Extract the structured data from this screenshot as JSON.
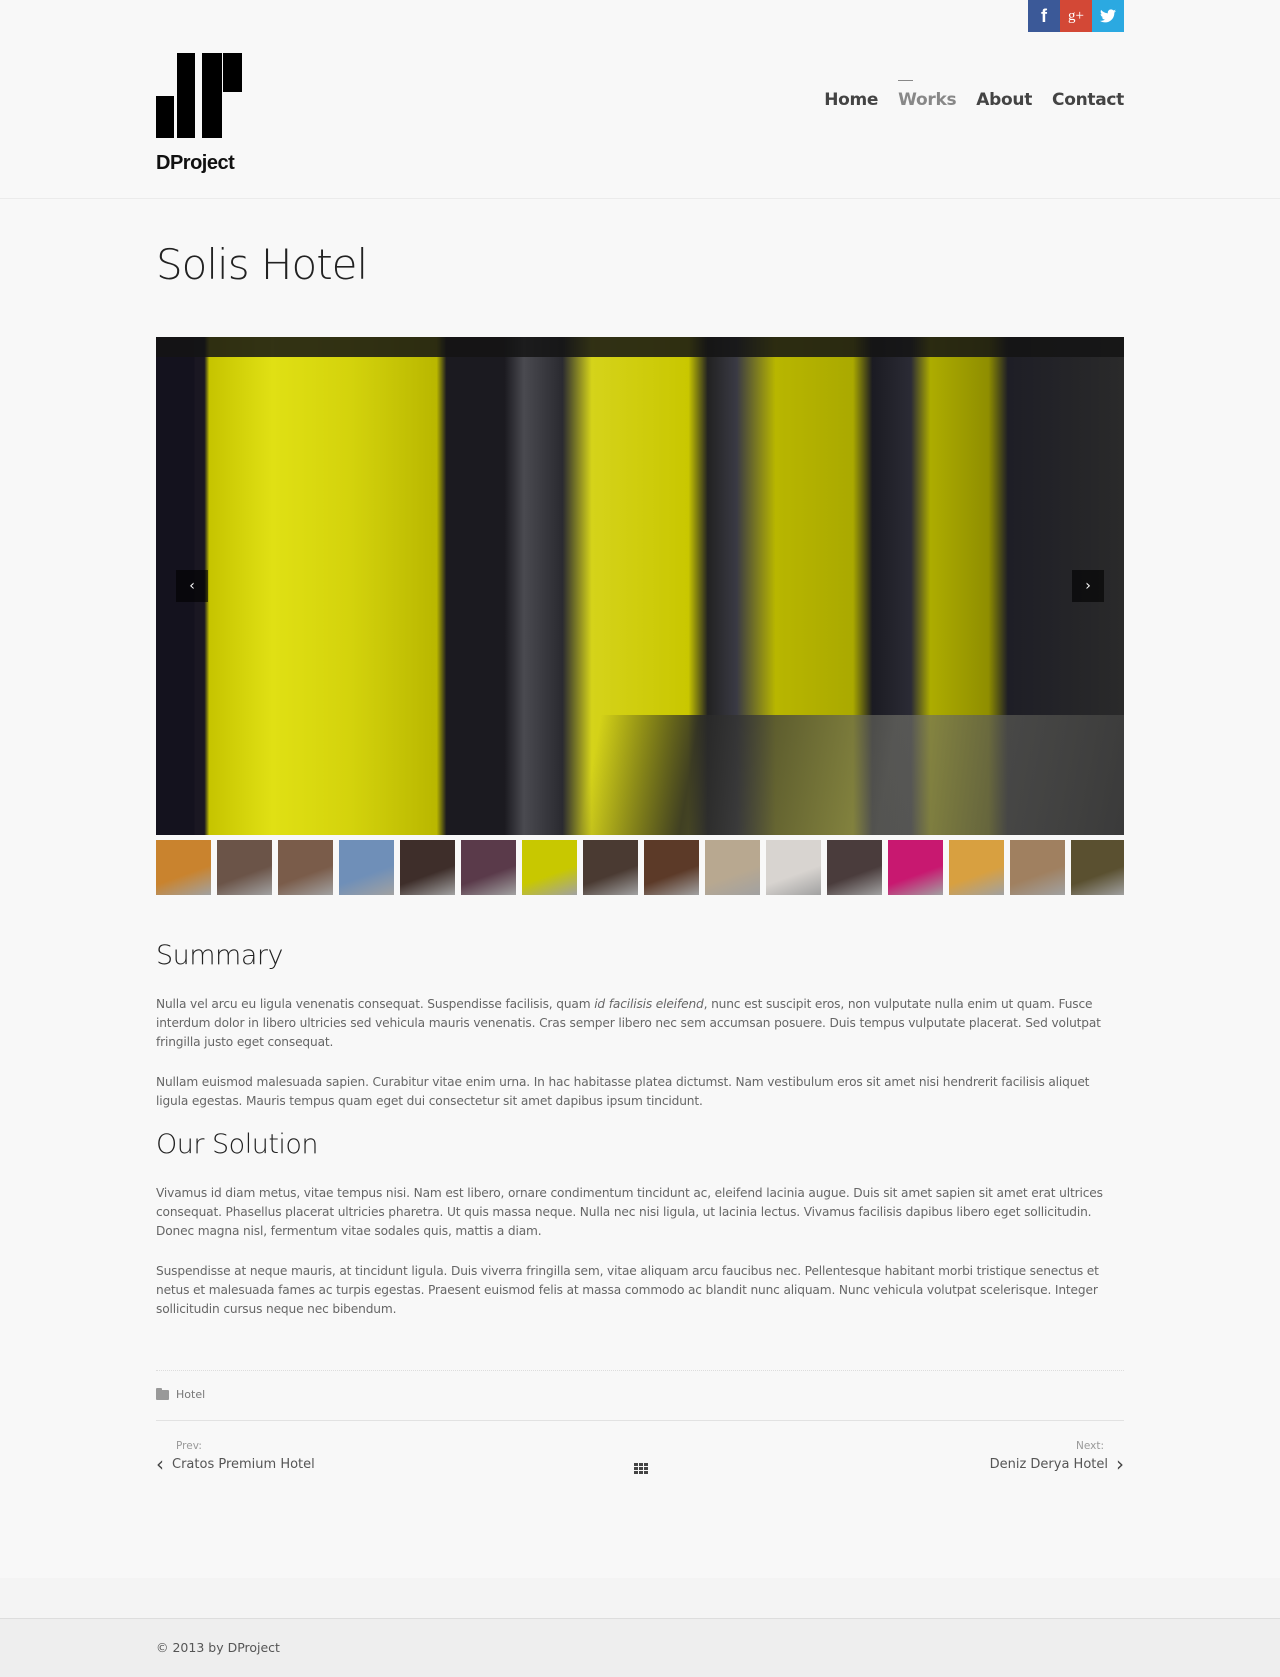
{
  "social": [
    {
      "name": "facebook",
      "glyph": "f",
      "color": "#3b5998"
    },
    {
      "name": "google-plus",
      "glyph": "g+",
      "color": "#d34836"
    },
    {
      "name": "twitter",
      "glyph": "🐦",
      "color": "#2ba9e1"
    }
  ],
  "brand": {
    "name": "DProject"
  },
  "nav": {
    "items": [
      {
        "label": "Home",
        "active": false
      },
      {
        "label": "Works",
        "active": true
      },
      {
        "label": "About",
        "active": false
      },
      {
        "label": "Contact",
        "active": false
      }
    ]
  },
  "page": {
    "title": "Solis Hotel"
  },
  "slider": {
    "prev_glyph": "‹",
    "next_glyph": "›",
    "thumbnails": [
      {
        "desc": "orange sofa",
        "color": "#c9832e"
      },
      {
        "desc": "white shelf",
        "color": "#6b5448"
      },
      {
        "desc": "lobby lounge",
        "color": "#7a5c4a"
      },
      {
        "desc": "mountain view",
        "color": "#6f8fb8"
      },
      {
        "desc": "dark corridor",
        "color": "#3e2e2a"
      },
      {
        "desc": "purple room",
        "color": "#5a3a4a"
      },
      {
        "desc": "yellow elevators",
        "color": "#c8c800"
      },
      {
        "desc": "brown room",
        "color": "#4a3a32"
      },
      {
        "desc": "wood desk",
        "color": "#5c3a28"
      },
      {
        "desc": "white sofa yellow pillows",
        "color": "#b8a890"
      },
      {
        "desc": "bedroom",
        "color": "#d8d4d0"
      },
      {
        "desc": "lounge table",
        "color": "#4a3c3c"
      },
      {
        "desc": "magenta sofa",
        "color": "#c81870"
      },
      {
        "desc": "golden panel",
        "color": "#d8a040"
      },
      {
        "desc": "wood hall",
        "color": "#a08060"
      },
      {
        "desc": "yellow wall",
        "color": "#5a5030"
      }
    ]
  },
  "sections": {
    "summary": {
      "heading": "Summary",
      "p1_a": "Nulla vel arcu eu ligula venenatis consequat. Suspendisse facilisis, quam ",
      "p1_em": "id facilisis eleifend",
      "p1_b": ", nunc est suscipit eros, non vulputate nulla enim ut quam. Fusce interdum dolor in libero ultricies sed vehicula mauris venenatis. Cras semper libero nec sem accumsan posuere. Duis tempus vulputate placerat. Sed volutpat fringilla justo eget consequat.",
      "p2": "Nullam euismod malesuada sapien. Curabitur vitae enim urna. In hac habitasse platea dictumst. Nam vestibulum eros sit amet nisi hendrerit facilisis aliquet ligula egestas. Mauris tempus quam eget dui consectetur sit amet dapibus ipsum tincidunt."
    },
    "solution": {
      "heading": "Our Solution",
      "p1": "Vivamus id diam metus, vitae tempus nisi. Nam est libero, ornare condimentum tincidunt ac, eleifend lacinia augue. Duis sit amet sapien sit amet erat ultrices consequat. Phasellus placerat ultricies pharetra. Ut quis massa neque. Nulla nec nisi ligula, ut lacinia lectus. Vivamus facilisis dapibus libero eget sollicitudin. Donec magna nisl, fermentum vitae sodales quis, mattis a diam.",
      "p2": "Suspendisse at neque mauris, at tincidunt ligula. Duis viverra fringilla sem, vitae aliquam arcu faucibus nec. Pellentesque habitant morbi tristique senectus et netus et malesuada fames ac turpis egestas. Praesent euismod felis at massa commodo ac blandit nunc aliquam. Nunc vehicula volutpat scelerisque. Integer sollicitudin cursus neque nec bibendum."
    }
  },
  "meta": {
    "category": "Hotel"
  },
  "post_nav": {
    "prev_label": "Prev:",
    "prev_title": "Cratos Premium Hotel",
    "next_label": "Next:",
    "next_title": "Deniz Derya Hotel",
    "prev_glyph": "‹",
    "next_glyph": "›"
  },
  "footer": {
    "copyright": "© 2013 by DProject"
  }
}
